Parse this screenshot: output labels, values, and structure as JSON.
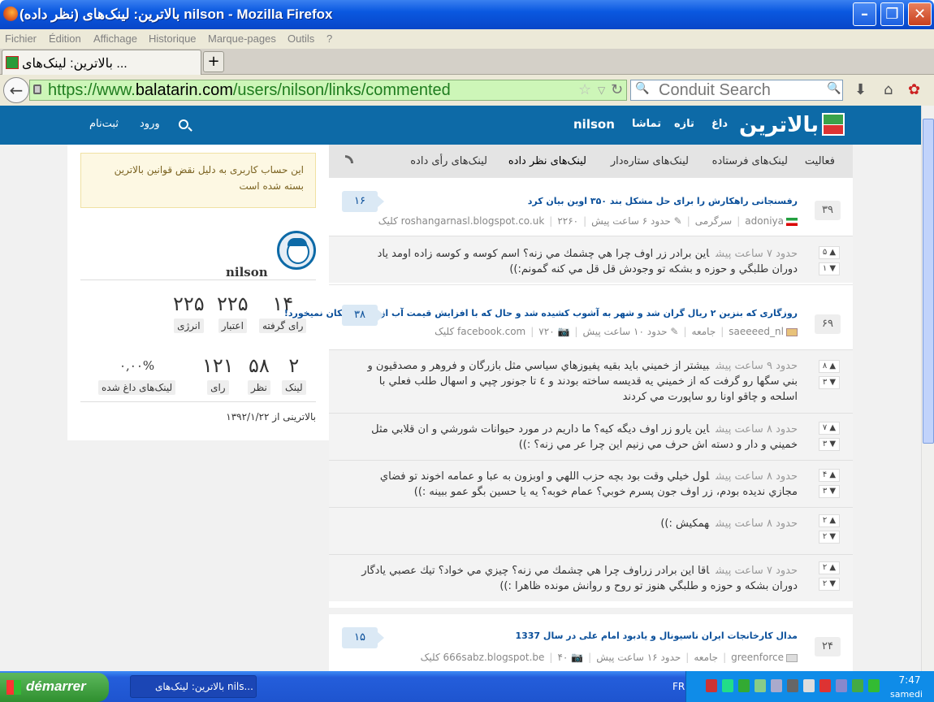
{
  "window": {
    "title": "بالاترین: لینک‌های (نظر داده) nilson - Mozilla Firefox"
  },
  "menu": [
    "Fichier",
    "Édition",
    "Affichage",
    "Historique",
    "Marque-pages",
    "Outils",
    "?"
  ],
  "tab": {
    "label": "بالاترین: لینک‌های ..."
  },
  "url": {
    "prefix": "https://www.",
    "domain": "balatarin.com",
    "path": "/users/nilson/links/commented"
  },
  "search": {
    "placeholder": "Conduit Search"
  },
  "site": {
    "logo": "بالاترین",
    "nav": [
      "داغ",
      "تازه",
      "تماشا"
    ],
    "user": "nilson",
    "login": "ورود",
    "signup": "ثبت‌نام"
  },
  "sidebar": {
    "notice": "این حساب کاربری به دلیل نقض قوانین بالاترین بسته شده است",
    "username": "nilson",
    "stats1": [
      {
        "value": "۱۴",
        "label": "رای گرفته"
      },
      {
        "value": "۲۲۵",
        "label": "اعتبار"
      },
      {
        "value": "۲۲۵",
        "label": "انرژی"
      }
    ],
    "stats2": [
      {
        "value": "۲",
        "label": "لینک"
      },
      {
        "value": "۵۸",
        "label": "نظر"
      },
      {
        "value": "۱۲۱",
        "label": "رای"
      },
      {
        "value": "۰,۰۰%",
        "label": "لینک‌های داغ شده"
      }
    ],
    "since": "بالاترینی از ۱۳۹۲/۱/۲۲"
  },
  "tabs": [
    "فعالیت",
    "لینک‌های فرستاده",
    "لینک‌های ستاره‌دار",
    "لینک‌های نظر داده",
    "لینک‌های رأی داده"
  ],
  "stories": [
    {
      "votes": "۳۹",
      "title": "رفسنجانی راهکارش را برای حل مشکل بند ۳۵۰ اوین بیان کرد",
      "user": "adoniya",
      "category": "سرگرمی",
      "time": "حدود ۶ ساعت پیش",
      "source": "roshangarnasl.blogspot.co.uk",
      "clicks": "۲۲۶۰ کلیک",
      "comments": "۱۶",
      "replies": [
        {
          "time": "حدود ۷ ساعت پیش",
          "text": "اين برادر زر اوف چرا هي چشمك مي زنه؟ اسم كوسه و كوسه زاده اومد ياد دوران طلبگي و حوزه و بشكه تو وجودش قل قل مي كنه گمونم:))",
          "up": "۵",
          "down": "۱"
        }
      ]
    },
    {
      "votes": "۶۹",
      "title": "روزگاری که بنزین ۲ ریال گران شد و شهر به آشوب کشیده شد و حال که با افزایش قیمت آب از آب هم تکان نمیخورد!",
      "user": "saeeeed_nl",
      "category": "جامعه",
      "time": "حدود ۱۰ ساعت پیش",
      "source": "facebook.com",
      "clicks": "۷۲۰ کلیک",
      "comments": "۳۸",
      "replies": [
        {
          "time": "حدود ۹ ساعت پیش",
          "text": "بيشتر از خميني بايد بقيه پفيوزهاي سياسي مثل بازرگان و فروهر و مصدقيون و بني سگها رو گرفت كه از خميني يه قديسه ساخته بودند و ٤ تا جونور چپي و اسهال طلب فعلي با اسلحه و چاقو اونا رو ساپورت مي كردند",
          "up": "۸",
          "down": "۳"
        },
        {
          "time": "حدود ۸ ساعت پیش",
          "text": "اين يارو زر اوف ديگه كيه؟ ما داريم در مورد حيوانات شورشي و ان قلابي مثل خميني و دار و دسته اش حرف مي زنيم اين چرا عر مي زنه؟ :))",
          "up": "۷",
          "down": "۳"
        },
        {
          "time": "حدود ۸ ساعت پیش",
          "text": "لول خيلي وقت بود بچه حزب اللهي و اوبزون به عبا و عمامه اخوند تو فضاي مجازي نديده بودم، زر اوف جون پسرم خوبي؟ عمام خوبه؟ يه يا حسين بگو عمو ببينه :))",
          "up": "۴",
          "down": "۳"
        },
        {
          "time": "حدود ۸ ساعت پیش",
          "text": "همكيش :))",
          "up": "۲",
          "down": "۲"
        },
        {
          "time": "حدود ۷ ساعت پیش",
          "text": "اقا اين برادر زراوف چرا هي چشمك مي زنه؟ چيزي مي خواد؟ تيك عصبي يادگار دوران بشكه و حوزه و طلبگي هنوز تو روح و روانش مونده ظاهرا :))",
          "up": "۲",
          "down": "۲"
        }
      ]
    },
    {
      "votes": "۲۴",
      "title": "مدال کارخانجات ایران ناسیونال و یادبود امام علی در سال 1337",
      "user": "greenforce",
      "category": "جامعه",
      "time": "حدود ۱۶ ساعت پیش",
      "source": "666sabz.blogspot.be",
      "clicks": "۴۰ کلیک",
      "comments": "۱۵",
      "replies": []
    }
  ],
  "taskbar": {
    "start": "démarrer",
    "item": "بالاترین: لینک‌های nils...",
    "lang": "FR",
    "time": "7:47",
    "day": "samedi"
  }
}
